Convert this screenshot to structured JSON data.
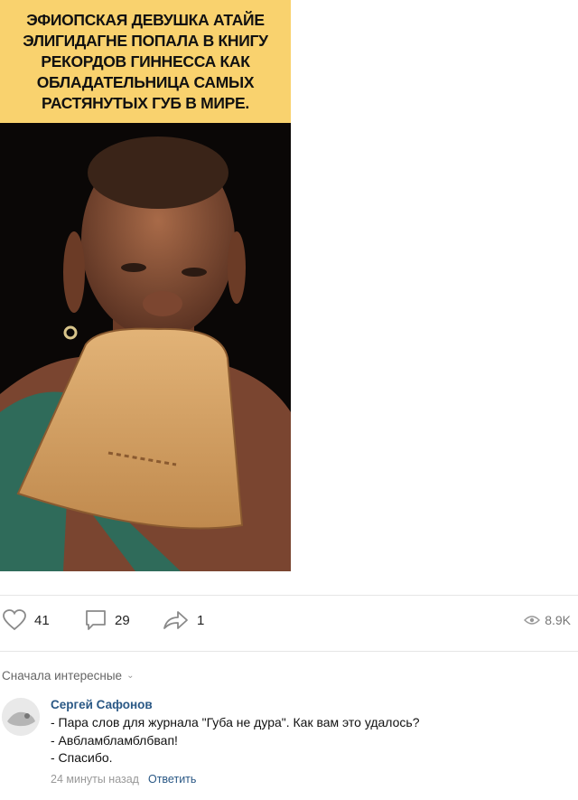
{
  "post": {
    "caption": "ЭФИОПСКАЯ ДЕВУШКА АТАЙЕ\nЭЛИГИДАГНЕ ПОПАЛА В КНИГУ\nРЕКОРДОВ ГИННЕССА КАК\nОБЛАДАТЕЛЬНИЦА САМЫХ\nРАСТЯНУТЫХ ГУБ В МИРЕ.",
    "caption_bg": "#f9d26e"
  },
  "actions": {
    "likes": "41",
    "comments": "29",
    "shares": "1",
    "views": "8.9K",
    "icons": [
      "heart-icon",
      "comment-icon",
      "share-icon",
      "eye-icon"
    ]
  },
  "comments_section": {
    "sort_label": "Сначала интересные",
    "comment": {
      "author": "Сергей Сафонов",
      "lines": [
        "- Пара слов для журнала \"Губа не дура\". Как вам это удалось?",
        "- Авбламбламблбвап!",
        "- Спасибо."
      ],
      "time": "24 минуты назад",
      "reply_label": "Ответить"
    }
  },
  "colors": {
    "link": "#2a5885",
    "muted": "#999999"
  }
}
